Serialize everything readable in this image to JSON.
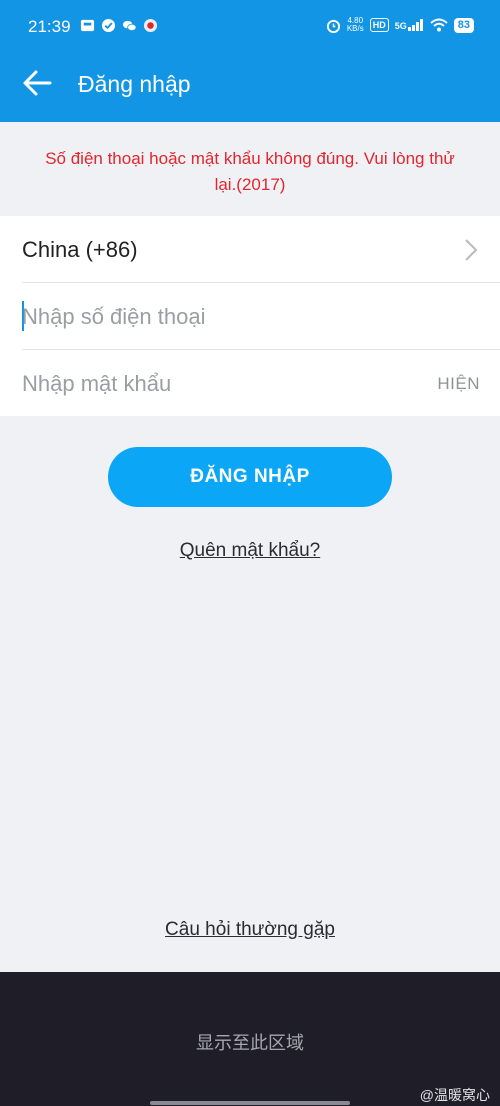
{
  "status_bar": {
    "time": "21:39",
    "net_speed_value": "4.80",
    "net_speed_unit": "KB/s",
    "hd_label": "HD",
    "signal_label": "5G",
    "battery": "83",
    "icons": [
      "gallery-icon",
      "check-circle-icon",
      "wechat-icon",
      "app-notification-icon",
      "alarm-icon",
      "signal-icon",
      "wifi-icon",
      "battery-icon"
    ]
  },
  "app_bar": {
    "title": "Đăng nhập",
    "back_icon": "arrow-left-icon"
  },
  "error": {
    "message": "Số điện thoại hoặc mật khẩu không đúng. Vui lòng thử lại.(2017)"
  },
  "form": {
    "country": "China (+86)",
    "phone_placeholder": "Nhập số điện thoại",
    "password_placeholder": "Nhập mật khẩu",
    "show_label": "HIỆN"
  },
  "actions": {
    "login_label": "ĐĂNG NHẬP",
    "forgot_label": "Quên mật khẩu?",
    "faq_label": "Câu hỏi thường gặp"
  },
  "footer": {
    "overlay_text": "显示至此区域",
    "watermark": "@温暖窝心"
  },
  "colors": {
    "primary": "#1195e4",
    "button": "#0ba6f5",
    "error": "#e2262f",
    "background": "#f0f1f5",
    "footer": "#1f1e28"
  }
}
